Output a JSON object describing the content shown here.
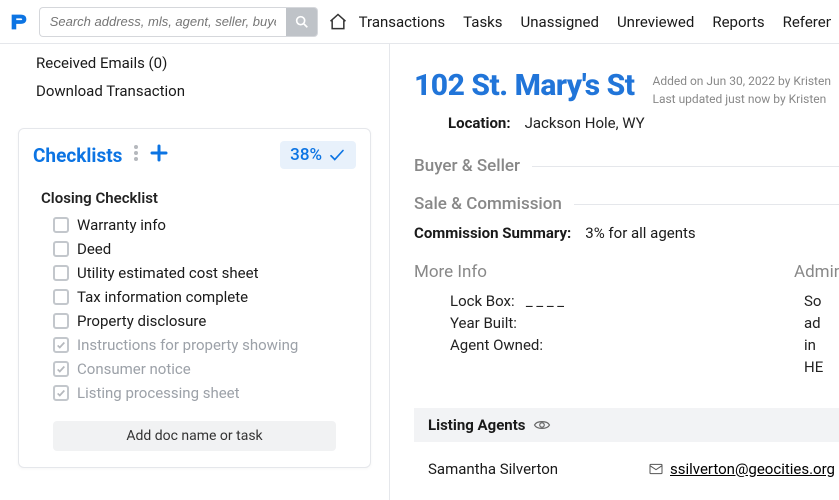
{
  "search": {
    "placeholder": "Search address, mls, agent, seller, buyer"
  },
  "nav": {
    "items": [
      "Transactions",
      "Tasks",
      "Unassigned",
      "Unreviewed",
      "Reports",
      "References"
    ]
  },
  "sidebar_links": {
    "received_emails": "Received Emails (0)",
    "download_tx": "Download Transaction"
  },
  "checklists": {
    "title": "Checklists",
    "percent": "38%",
    "group_title": "Closing Checklist",
    "items": [
      {
        "label": "Warranty info",
        "done": false
      },
      {
        "label": "Deed",
        "done": false
      },
      {
        "label": "Utility estimated cost sheet",
        "done": false
      },
      {
        "label": "Tax information complete",
        "done": false
      },
      {
        "label": "Property disclosure",
        "done": false
      },
      {
        "label": "Instructions for property showing",
        "done": true
      },
      {
        "label": "Consumer notice",
        "done": true
      },
      {
        "label": "Listing processing sheet",
        "done": true
      }
    ],
    "add_task": "Add doc name or task"
  },
  "detail": {
    "title": "102 St. Mary's St",
    "meta1": "Added on Jun 30, 2022 by Kristen",
    "meta2": "Last updated just now by Kristen",
    "location_label": "Location:",
    "location_value": "Jackson Hole, WY",
    "buyer_seller_title": "Buyer & Seller",
    "sale_commission_title": "Sale & Commission",
    "commission_label": "Commission Summary:",
    "commission_value": "3% for all agents",
    "more_info_title": "More Info",
    "admin_title": "Admin Info",
    "lock_box_label": "Lock Box:",
    "lock_box_value": "_ _ _ _",
    "year_built_label": "Year Built:",
    "agent_owned_label": "Agent Owned:",
    "admin_lines": [
      "So",
      "ad",
      "in",
      "HE"
    ],
    "listing_agents_title": "Listing Agents",
    "agent_name": "Samantha Silverton",
    "agent_email": "ssilverton@geocities.org"
  }
}
